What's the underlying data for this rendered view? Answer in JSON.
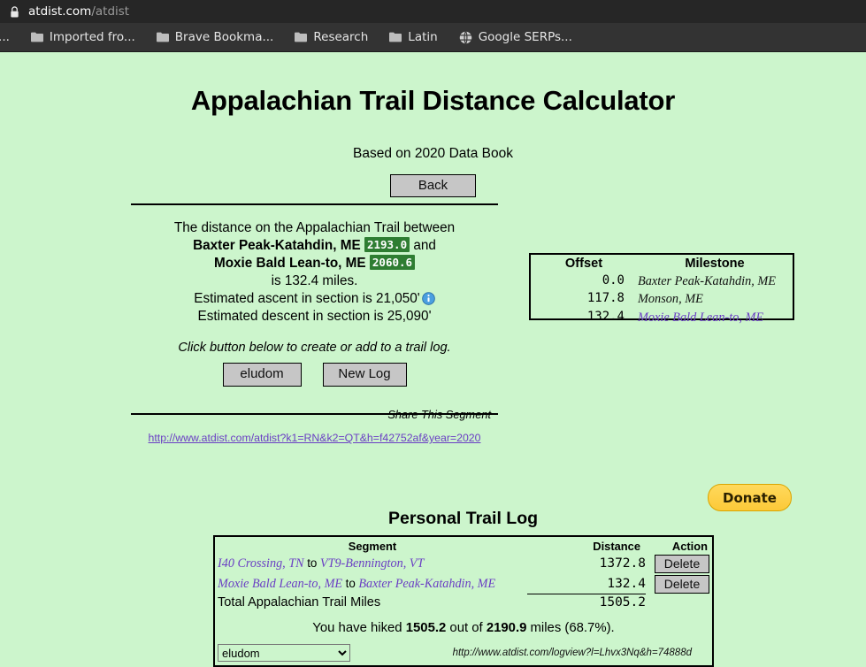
{
  "browser": {
    "lock_icon": "lock-icon",
    "url_host": "atdist.com",
    "url_path": "/atdist",
    "bookmarks": [
      {
        "label": "o...",
        "icon": "folder-icon"
      },
      {
        "label": "Imported fro...",
        "icon": "folder-icon"
      },
      {
        "label": "Brave Bookma...",
        "icon": "folder-icon"
      },
      {
        "label": "Research",
        "icon": "folder-icon"
      },
      {
        "label": "Latin",
        "icon": "folder-icon"
      },
      {
        "label": "Google SERPs...",
        "icon": "globe-icon"
      }
    ]
  },
  "page": {
    "title": "Appalachian Trail Distance Calculator",
    "subtitle": "Based on 2020 Data Book",
    "back_label": "Back"
  },
  "summary": {
    "line1": "The distance on the Appalachian Trail between",
    "from_name": "Baxter Peak-Katahdin, ME",
    "from_offset": "2193.0",
    "and": "and",
    "to_name": "Moxie Bald Lean-to, ME",
    "to_offset": "2060.6",
    "distance_line": "is 132.4 miles.",
    "ascent_line": "Estimated ascent in section is 21,050'",
    "info_icon": "info-icon",
    "descent_line": "Estimated descent in section is 25,090'",
    "hint": "Click button below to create or add to a trail log.",
    "log_button": "eludom",
    "new_log_button": "New Log",
    "share_label": "Share This Segment",
    "share_url": "http://www.atdist.com/atdist?k1=RN&k2=QT&h=f42752af&year=2020"
  },
  "milestones": {
    "headers": {
      "offset": "Offset",
      "milestone": "Milestone"
    },
    "rows": [
      {
        "offset": "0.0",
        "name": "Baxter Peak-Katahdin, ME",
        "is_link": false
      },
      {
        "offset": "117.8",
        "name": "Monson, ME",
        "is_link": false
      },
      {
        "offset": "132.4",
        "name": "Moxie Bald Lean-to, ME",
        "is_link": true
      }
    ]
  },
  "donate": {
    "label": "Donate"
  },
  "trail_log": {
    "title": "Personal Trail Log",
    "headers": {
      "segment": "Segment",
      "distance": "Distance",
      "action": "Action"
    },
    "rows": [
      {
        "from": "I40 Crossing, TN",
        "to": "to",
        "dest": "VT9-Bennington, VT",
        "distance": "1372.8",
        "action": "Delete"
      },
      {
        "from": "Moxie Bald Lean-to, ME",
        "to": "to",
        "dest": "Baxter Peak-Katahdin, ME",
        "distance": "132.4",
        "action": "Delete"
      }
    ],
    "total_label": "Total Appalachian Trail Miles",
    "total_value": "1505.2",
    "hiked_prefix": "You have hiked",
    "hiked_value": "1505.2",
    "hiked_mid": "out of",
    "hiked_total": "2190.9",
    "hiked_suffix": "miles (68.7%).",
    "select_value": "eludom",
    "log_url": "http://www.atdist.com/logview?l=Lhvx3Nq&h=74888d"
  },
  "colors": {
    "page_bg": "#ccf5cc",
    "link": "#6a3fc4",
    "badge_green": "#2e7d32",
    "donate_yellow": "#fcc938"
  }
}
